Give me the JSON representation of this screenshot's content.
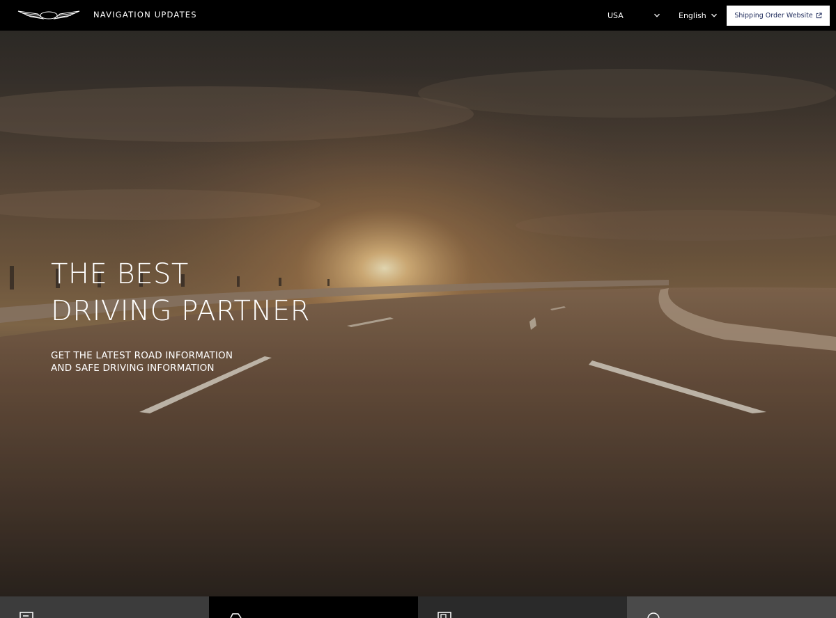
{
  "header": {
    "logo_icon": "genesis-wings-logo-icon",
    "title": "NAVIGATION UPDATES",
    "country": {
      "selected": "USA",
      "icon": "chevron-down-icon"
    },
    "language": {
      "selected": "English",
      "icon": "chevron-down-icon"
    },
    "shipping_button": {
      "label": "Shipping Order Website",
      "icon": "external-link-icon"
    }
  },
  "hero": {
    "title_line1": "THE BEST",
    "title_line2": "DRIVING PARTNER",
    "subtitle_line1": "GET THE LATEST ROAD INFORMATION",
    "subtitle_line2": "AND SAFE DRIVING INFORMATION",
    "background": "sunset-highway-image"
  },
  "tiles": [
    {
      "icon": "document-icon",
      "color": "#3c3c3c"
    },
    {
      "icon": "car-icon",
      "color": "#000000"
    },
    {
      "icon": "map-book-icon",
      "color": "#2a2a2a"
    },
    {
      "icon": "search-icon",
      "color": "#4a4a4a"
    }
  ],
  "colors": {
    "header_bg": "#000000",
    "button_bg": "#ffffff",
    "button_text": "#1d2a5a"
  }
}
